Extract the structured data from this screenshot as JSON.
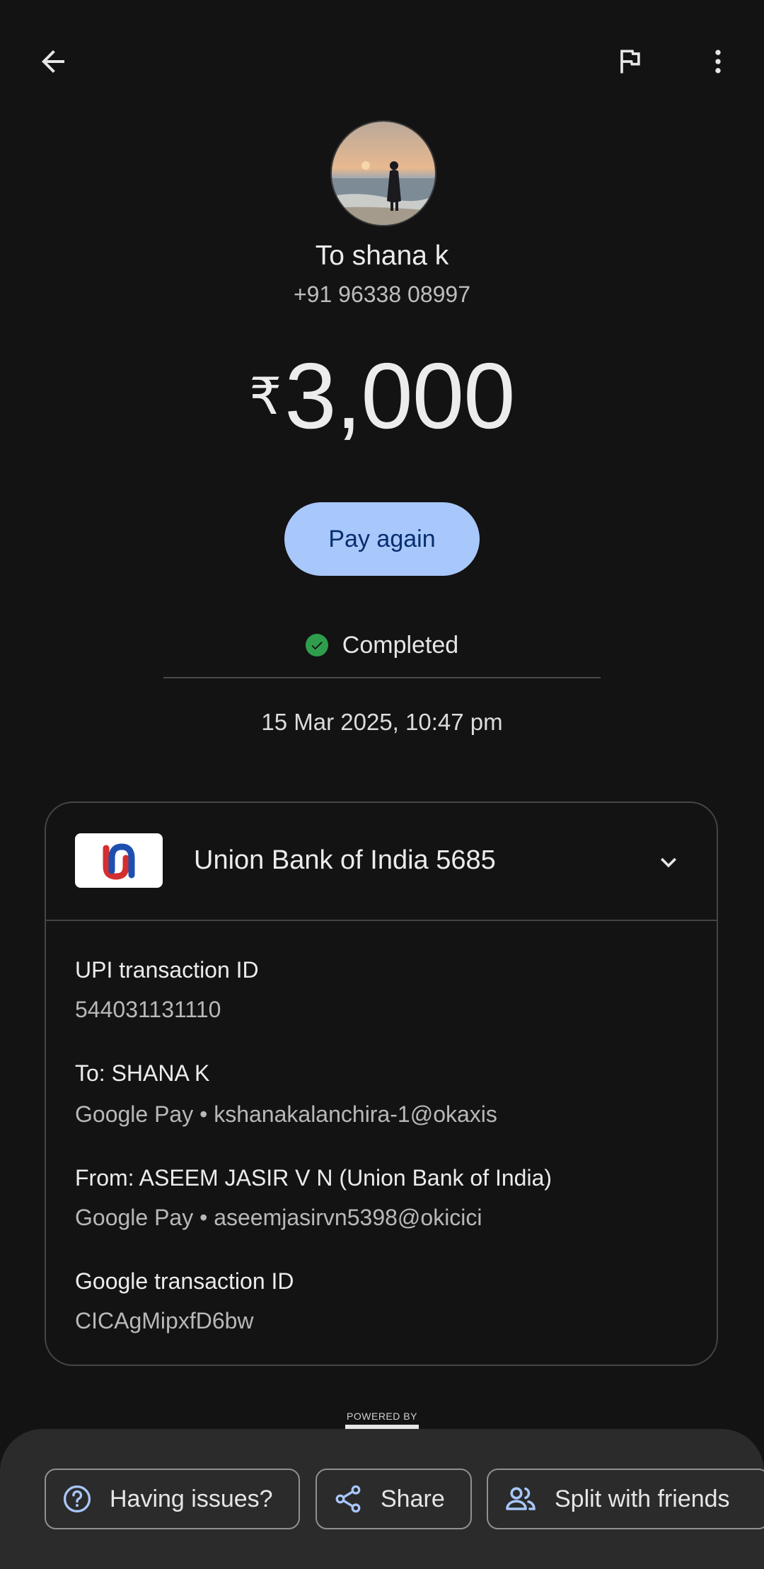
{
  "header": {
    "back_icon": "arrow-back-icon",
    "flag_icon": "flag-icon",
    "more_icon": "more-vert-icon"
  },
  "recipient": {
    "label": "To shana k",
    "phone": "+91 96338 08997"
  },
  "amount": {
    "currency": "₹",
    "value": "3,000"
  },
  "pay_again_label": "Pay again",
  "status": {
    "text": "Completed",
    "color": "#2f9e4c"
  },
  "datetime": "15 Mar 2025, 10:47 pm",
  "account": {
    "bank_name": "Union Bank of India 5685"
  },
  "details": {
    "upi_label": "UPI transaction ID",
    "upi_value": "544031131110",
    "to_label": "To: SHANA  K",
    "to_value": "Google Pay • kshanakalanchira-1@okaxis",
    "from_label": "From: ASEEM JASIR V N (Union Bank of India)",
    "from_value": "Google Pay • aseemjasirvn5398@okicici",
    "google_label": "Google transaction ID",
    "google_value": "CICAgMipxfD6bw"
  },
  "powered_by": "POWERED BY",
  "actions": {
    "issues": "Having issues?",
    "share": "Share",
    "split": "Split with friends"
  },
  "colors": {
    "accent": "#a8c7fa",
    "background": "#131313",
    "sheet": "#2b2b2b"
  }
}
